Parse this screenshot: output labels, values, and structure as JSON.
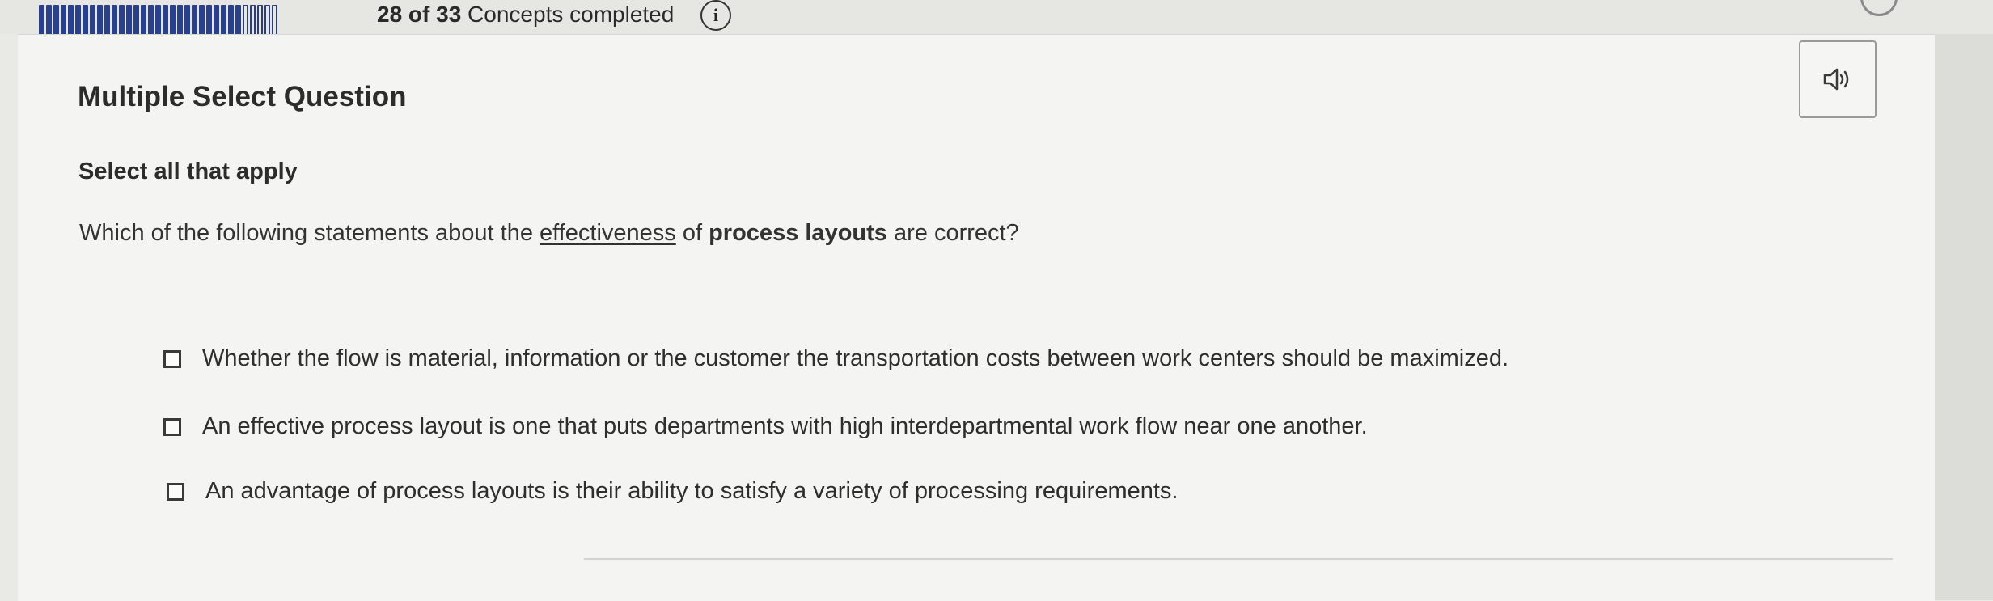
{
  "progress": {
    "completed": 28,
    "total": 33,
    "count_text": "28 of 33",
    "suffix_text": " Concepts completed"
  },
  "icons": {
    "info": "info-icon",
    "audio": "speaker-icon"
  },
  "question": {
    "type_label": "Multiple Select Question",
    "instruction": "Select all that apply",
    "stem_before": "Which of the following statements about the ",
    "stem_underlined": "effectiveness",
    "stem_middle": " of ",
    "stem_bold": "process layouts",
    "stem_after": " are correct?"
  },
  "options": [
    {
      "label": "Whether the flow is material, information or the customer the transportation costs between work centers should be maximized.",
      "checked": false
    },
    {
      "label": "An effective process layout is one that puts departments with high interdepartmental work flow near one another.",
      "checked": false
    },
    {
      "label": "An advantage of process layouts is their ability to satisfy a variety of processing requirements.",
      "checked": false
    }
  ],
  "colors": {
    "progress_fill": "#28408e",
    "background": "#f4f4f2"
  }
}
